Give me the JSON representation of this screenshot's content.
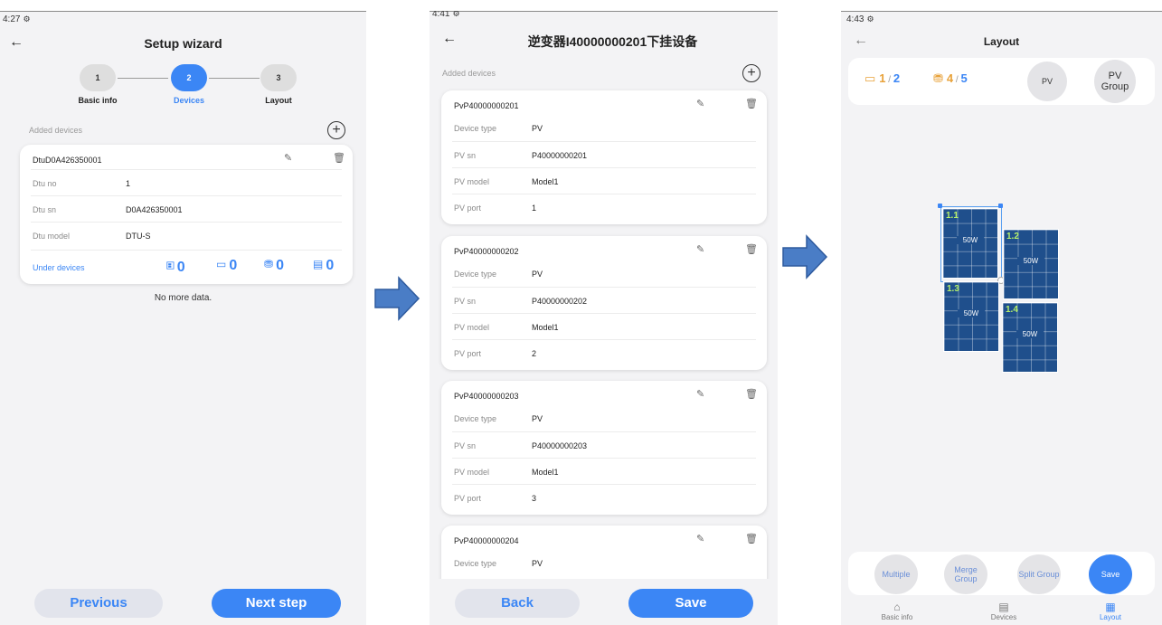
{
  "wizard": {
    "status_time": "4:27",
    "title": "Setup wizard",
    "steps": [
      {
        "num": "1",
        "label": "Basic info"
      },
      {
        "num": "2",
        "label": "Devices"
      },
      {
        "num": "3",
        "label": "Layout"
      }
    ],
    "added_devices_label": "Added devices",
    "dtu_card": {
      "title": "DtuD0A426350001",
      "rows": [
        {
          "key": "Dtu no",
          "value": "1"
        },
        {
          "key": "Dtu sn",
          "value": "D0A426350001"
        },
        {
          "key": "Dtu model",
          "value": "DTU-S"
        }
      ],
      "under_devices_label": "Under devices",
      "counts": [
        "0",
        "0",
        "0",
        "0"
      ]
    },
    "no_more": "No more data.",
    "previous_label": "Previous",
    "next_label": "Next step"
  },
  "inverter": {
    "status_time": "4:41",
    "title": "逆变器I40000000201下挂设备",
    "added_devices_label": "Added devices",
    "cards": [
      {
        "title": "PvP40000000201",
        "rows": [
          {
            "key": "Device type",
            "value": "PV"
          },
          {
            "key": "PV sn",
            "value": "P40000000201"
          },
          {
            "key": "PV model",
            "value": "Model1"
          },
          {
            "key": "PV port",
            "value": "1"
          }
        ]
      },
      {
        "title": "PvP40000000202",
        "rows": [
          {
            "key": "Device type",
            "value": "PV"
          },
          {
            "key": "PV sn",
            "value": "P40000000202"
          },
          {
            "key": "PV model",
            "value": "Model1"
          },
          {
            "key": "PV port",
            "value": "2"
          }
        ]
      },
      {
        "title": "PvP40000000203",
        "rows": [
          {
            "key": "Device type",
            "value": "PV"
          },
          {
            "key": "PV sn",
            "value": "P40000000203"
          },
          {
            "key": "PV model",
            "value": "Model1"
          },
          {
            "key": "PV port",
            "value": "3"
          }
        ]
      },
      {
        "title": "PvP40000000204",
        "rows": [
          {
            "key": "Device type",
            "value": "PV"
          }
        ]
      }
    ],
    "back_label": "Back",
    "save_label": "Save"
  },
  "layout": {
    "status_time": "4:43",
    "title": "Layout",
    "stat1_current": "1",
    "stat1_total": "2",
    "stat2_current": "4",
    "stat2_total": "5",
    "pv_button": "PV",
    "pv_group_button": "PV Group",
    "panels": [
      {
        "id": "1.1",
        "power": "50W"
      },
      {
        "id": "1.2",
        "power": "50W"
      },
      {
        "id": "1.3",
        "power": "50W"
      },
      {
        "id": "1.4",
        "power": "50W"
      }
    ],
    "actions": {
      "multiple": "Multiple",
      "merge_group": "Merge Group",
      "split_group": "Split Group",
      "save": "Save"
    },
    "tabs": [
      "Basic info",
      "Devices",
      "Layout"
    ],
    "colors": {
      "accent": "#3b86f5",
      "panel": "#1f4f8c",
      "panel_label": "#b6f06a",
      "stat1": "#e8a23a",
      "stat2": "#3b86f5"
    }
  }
}
